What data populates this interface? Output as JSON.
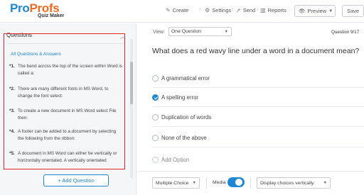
{
  "header": {
    "logo_part1": "Pro",
    "logo_part2": "Profs",
    "logo_sub": "Quiz Maker",
    "nav": {
      "create": "Create",
      "settings": "Settings",
      "send": "Send",
      "reports": "Reports"
    },
    "preview_label": "Preview",
    "save_label": "Save"
  },
  "sidebar": {
    "title": "Questions",
    "all_qa": "All Questions & Answers",
    "questions": [
      {
        "num": "*1.",
        "text": "The band across the top of the screen within Word is called a:"
      },
      {
        "num": "*2.",
        "text": "There are many different fonts in MS Word, to change the font select:"
      },
      {
        "num": "*3.",
        "text": "To create a new document in MS Word select File then:"
      },
      {
        "num": "*4.",
        "text": "A footer can be added to a document by selecting the following from the ribbon:"
      },
      {
        "num": "*5.",
        "text": "A document in MS Word can either be vertically or horizontally orientated. A vertically orientated"
      }
    ],
    "add_question_label": "+ Add Question"
  },
  "main": {
    "view_label": "View:",
    "view_value": "One Question",
    "question_count": "Question 9/17",
    "question_text": "What does a red wavy line under a word in a document mean?",
    "options": [
      {
        "label": "A grammatical error",
        "checked": false
      },
      {
        "label": "A spelling error",
        "checked": true
      },
      {
        "label": "Duplication of words",
        "checked": false
      },
      {
        "label": "None of the above",
        "checked": false
      }
    ],
    "add_option_label": "Add Option"
  },
  "toolbar": {
    "question_type": "Multiple Choice",
    "media_label": "Media",
    "media_enabled": true,
    "display_value": "Display choices vertically"
  },
  "colors": {
    "accent": "#1f86d6",
    "logo_orange": "#f26b22",
    "highlight_border": "#e0262b"
  }
}
